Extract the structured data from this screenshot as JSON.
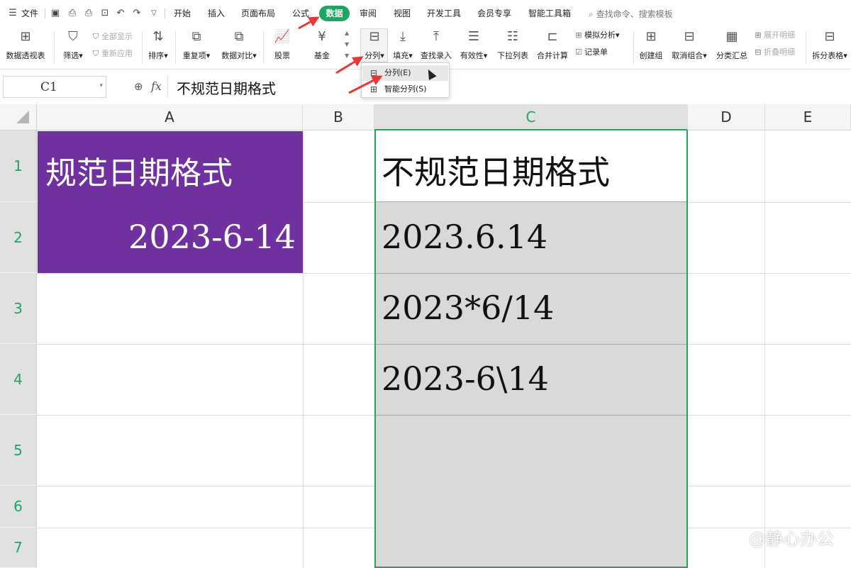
{
  "menubar": {
    "file_label": "文件",
    "tabs": [
      "开始",
      "插入",
      "页面布局",
      "公式",
      "数据",
      "审阅",
      "视图",
      "开发工具",
      "会员专享",
      "智能工具箱"
    ],
    "active_tab": "数据",
    "search_label": "查找命令、搜索模板"
  },
  "ribbon": {
    "pivot": "数据透视表",
    "filter": "筛选",
    "show_all": "全部显示",
    "reapply": "重新应用",
    "sort": "排序",
    "duplicates": "重复项",
    "compare": "数据对比",
    "stocks": "股票",
    "funds": "基金",
    "split": "分列",
    "fill": "填充",
    "lookup": "查找录入",
    "validity": "有效性",
    "dropdown_list": "下拉列表",
    "consolidate": "合并计算",
    "whatif": "模拟分析",
    "record_form": "记录单",
    "group": "创建组",
    "ungroup": "取消组合",
    "subtotal": "分类汇总",
    "expand_detail": "展开明细",
    "collapse_detail": "折叠明细",
    "split_table": "拆分表格"
  },
  "split_menu": {
    "item1": "分列(E)",
    "item2": "智能分列(S)"
  },
  "formula_bar": {
    "name_box": "C1",
    "fx": "fx",
    "content": "不规范日期格式"
  },
  "columns": [
    "A",
    "B",
    "C",
    "D",
    "E"
  ],
  "rows": [
    "1",
    "2",
    "3",
    "4",
    "5",
    "6",
    "7"
  ],
  "cells": {
    "A1": "规范日期格式",
    "A2": "2023-6-14",
    "C1": "不规范日期格式",
    "C2": "2023.6.14",
    "C3": "2023*6/14",
    "C4": "2023-6\\14"
  },
  "colors": {
    "accent": "#1fa463",
    "a_fill": "#7030a0",
    "c_fill": "#d9d9d9",
    "arrow": "#e53935"
  },
  "watermark": "@静心办公"
}
